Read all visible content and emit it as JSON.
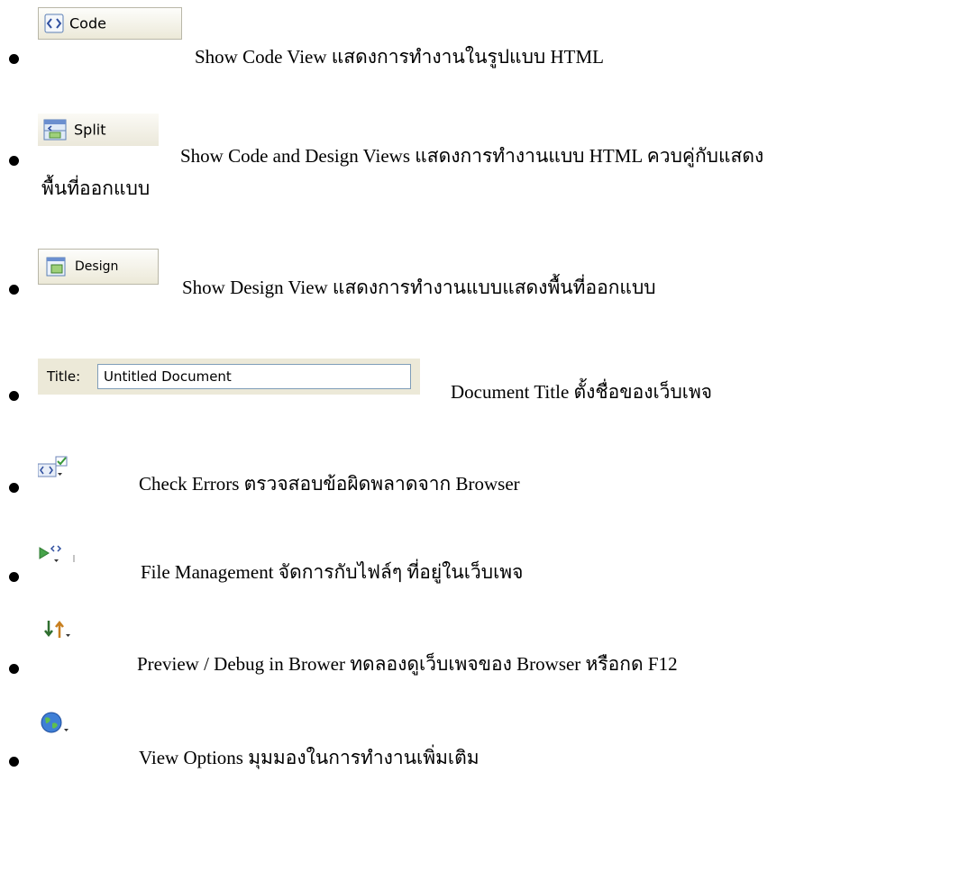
{
  "items": [
    {
      "button_label": "Code",
      "text": "Show Code View แสดงการทำงานในรูปแบบ HTML"
    },
    {
      "button_label": "Split",
      "text": "Show Code and Design Views แสดงการทำงานแบบ HTML ควบคู่กับแสดง",
      "text2": "พื้นที่ออกแบบ"
    },
    {
      "button_label": "Design",
      "text": "Show Design View แสดงการทำงานแบบแสดงพื้นที่ออกแบบ"
    },
    {
      "title_label": "Title:",
      "title_value": "Untitled Document",
      "text": "Document Title ตั้งชื่อของเว็บเพจ"
    },
    {
      "icon": "check-errors-icon",
      "text": "Check Errors ตรวจสอบข้อผิดพลาดจาก Browser"
    },
    {
      "icon": "file-management-icon",
      "text": "File Management จัดการกับไฟล์ๆ ที่อยู่ในเว็บเพจ"
    },
    {
      "icon": "preview-debug-icon",
      "text": "Preview / Debug in Brower ทดลองดูเว็บเพจของ Browser หรือกด F12"
    },
    {
      "icon": "globe-icon",
      "text": "View  Options มุมมองในการทำงานเพิ่มเติม"
    }
  ]
}
